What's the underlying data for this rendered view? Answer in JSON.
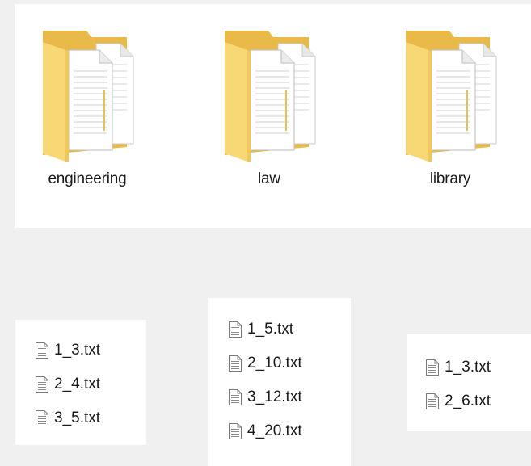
{
  "folders": [
    {
      "name": "engineering",
      "icon": "folder-documents-icon"
    },
    {
      "name": "law",
      "icon": "folder-documents-icon"
    },
    {
      "name": "library",
      "icon": "folder-documents-icon"
    }
  ],
  "file_lists": [
    {
      "files": [
        "1_3.txt",
        "2_4.txt",
        "3_5.txt"
      ]
    },
    {
      "files": [
        "1_5.txt",
        "2_10.txt",
        "3_12.txt",
        "4_20.txt"
      ]
    },
    {
      "files": [
        "1_3.txt",
        "2_6.txt"
      ]
    }
  ],
  "colors": {
    "background": "#f0f0f0",
    "panel": "#ffffff",
    "folder_front": "#f8d775",
    "folder_back": "#e8b94a",
    "text": "#1a1a1a"
  }
}
